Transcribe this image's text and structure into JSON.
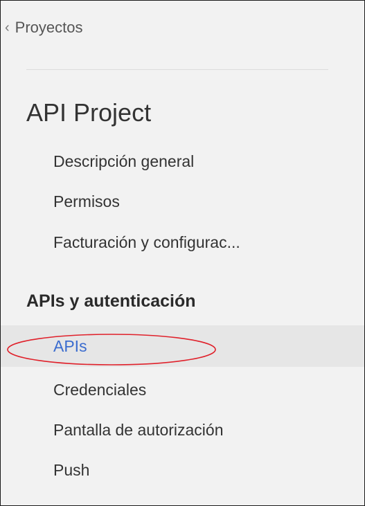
{
  "nav": {
    "back_label": "Proyectos",
    "project_title": "API Project",
    "project_items": [
      {
        "label": "Descripción general"
      },
      {
        "label": "Permisos"
      },
      {
        "label": "Facturación y configurac..."
      }
    ],
    "section_title": "APIs y autenticación",
    "section_items": [
      {
        "label": "APIs",
        "selected": true
      },
      {
        "label": "Credenciales"
      },
      {
        "label": "Pantalla de autorización"
      },
      {
        "label": "Push"
      }
    ]
  },
  "icons": {
    "back": "chevron-left-icon"
  },
  "colors": {
    "panel_background": "#f2f2f2",
    "selected_background": "#e6e6e6",
    "selected_text": "#3b6ccf",
    "annotation_ellipse": "#e0202a"
  }
}
